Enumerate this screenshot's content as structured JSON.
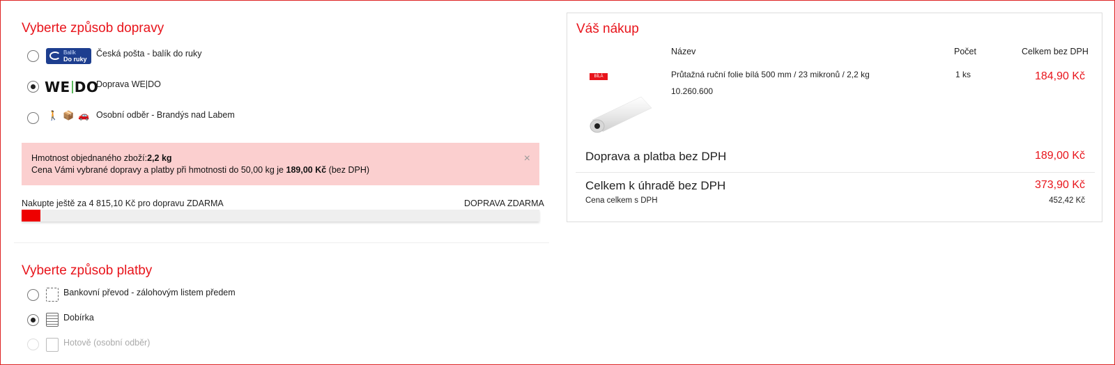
{
  "delivery": {
    "title": "Vyberte způsob dopravy",
    "options": [
      {
        "label": "Česká pošta - balík do ruky",
        "logo_line1": "Balík",
        "logo_line2": "Do ruky",
        "checked": false
      },
      {
        "label": "Doprava WE|DO",
        "logo_left": "WE",
        "logo_right": "DO",
        "checked": true
      },
      {
        "label": "Osobní odběr - Brandýs nad Labem",
        "checked": false
      }
    ]
  },
  "alert": {
    "weight_prefix": "Hmotnost objednaného zboží:",
    "weight_value": "2,2 kg",
    "price_prefix": "Cena Vámi vybrané dopravy a platby při hmotnosti do 50,00 kg je ",
    "price_value": "189,00  Kč",
    "price_suffix": " (bez DPH)",
    "close": "×"
  },
  "free_shipping": {
    "left_text": "Nakupte ještě za 4 815,10 Kč pro dopravu ZDARMA",
    "right_text": "DOPRAVA ZDARMA",
    "progress_percent": 3.7
  },
  "payment": {
    "title": "Vyberte způsob platby",
    "options": [
      {
        "label": "Bankovní převod - zálohovým listem předem",
        "checked": false,
        "disabled": false
      },
      {
        "label": "Dobírka",
        "checked": true,
        "disabled": false
      },
      {
        "label": "Hotově (osobní odběr)",
        "checked": false,
        "disabled": true
      }
    ]
  },
  "cart": {
    "title": "Váš nákup",
    "headers": {
      "name": "Název",
      "qty": "Počet",
      "total": "Celkem bez DPH"
    },
    "item": {
      "badge": "BÍLÁ",
      "name": "Průtažná ruční folie bílá 500 mm / 23 mikronů / 2,2 kg",
      "code": "10.260.600",
      "qty": "1 ks",
      "price": "184,90 Kč"
    },
    "shipping_label": "Doprava a platba bez DPH",
    "shipping_value": "189,00 Kč",
    "total_label": "Celkem k úhradě bez DPH",
    "total_value": "373,90 Kč",
    "vat_label": "Cena celkem s DPH",
    "vat_value": "452,42 Kč"
  },
  "colors": {
    "accent": "#e8141b",
    "alert_bg": "#fbcfcf",
    "progress_fill": "#ee0000",
    "balik_blue": "#1d3e8f"
  }
}
